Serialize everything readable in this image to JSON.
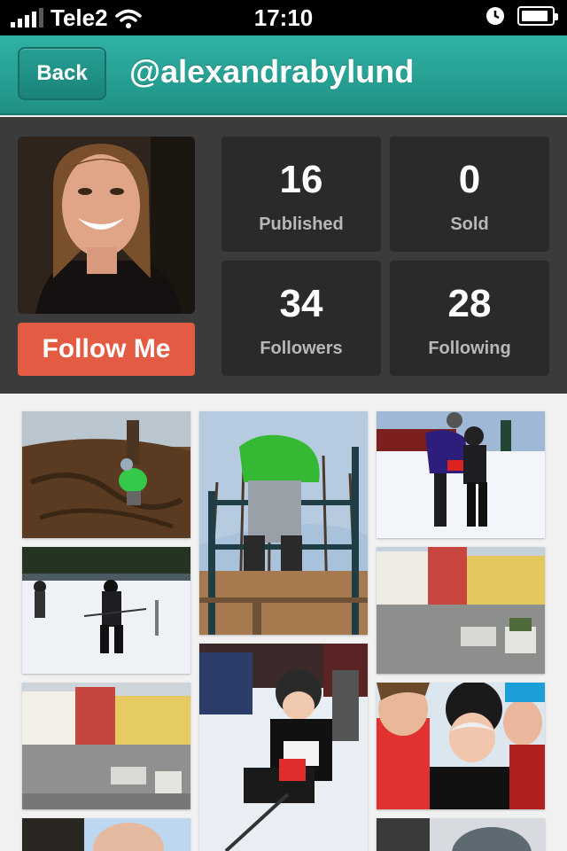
{
  "status_bar": {
    "carrier": "Tele2",
    "time": "17:10",
    "battery_level": 0.85
  },
  "nav": {
    "back_label": "Back",
    "title": "@alexandrabylund"
  },
  "profile": {
    "follow_label": "Follow Me",
    "stats": {
      "published": {
        "value": "16",
        "label": "Published"
      },
      "sold": {
        "value": "0",
        "label": "Sold"
      },
      "followers": {
        "value": "34",
        "label": "Followers"
      },
      "following": {
        "value": "28",
        "label": "Following"
      }
    }
  },
  "colors": {
    "accent": "#2fb2a4",
    "follow": "#e35b42",
    "panel": "#3b3b3b",
    "stat_tile": "#2a2a2a"
  },
  "photos": [
    {
      "name": "photo-child-on-tree-roots"
    },
    {
      "name": "photo-child-on-ladder"
    },
    {
      "name": "photo-parent-and-child-skiing"
    },
    {
      "name": "photo-child-skier-on-slope"
    },
    {
      "name": "photo-town-square"
    },
    {
      "name": "photo-town-square-2"
    },
    {
      "name": "photo-child-on-sled"
    },
    {
      "name": "photo-family-selfie"
    },
    {
      "name": "photo-partial-left"
    },
    {
      "name": "photo-partial-right"
    }
  ]
}
